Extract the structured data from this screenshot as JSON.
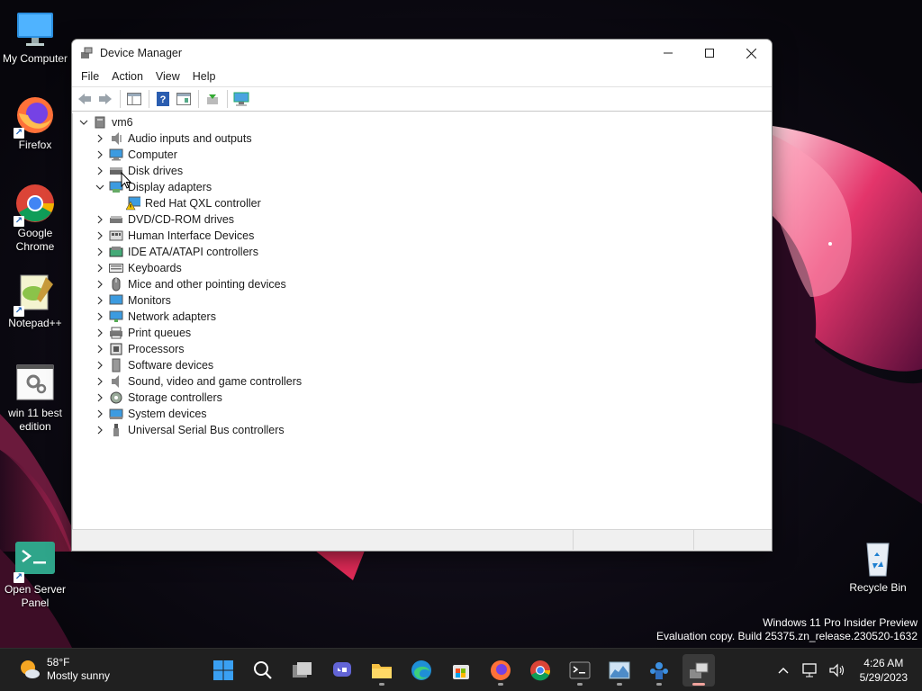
{
  "desktop": {
    "icons": [
      {
        "label": "My Computer"
      },
      {
        "label": "Firefox"
      },
      {
        "label": "Google Chrome"
      },
      {
        "label": "Notepad++"
      },
      {
        "label": "win 11 best edition"
      },
      {
        "label": "Open Server Panel"
      },
      {
        "label": "Recycle Bin"
      }
    ]
  },
  "window": {
    "title": "Device Manager",
    "menu": [
      "File",
      "Action",
      "View",
      "Help"
    ],
    "tree": {
      "root": "vm6",
      "items": [
        {
          "label": "Audio inputs and outputs",
          "icon": "speaker-icon"
        },
        {
          "label": "Computer",
          "icon": "computer-icon"
        },
        {
          "label": "Disk drives",
          "icon": "disk-drive-icon"
        },
        {
          "label": "Display adapters",
          "icon": "display-adapter-icon",
          "expanded": true,
          "children": [
            {
              "label": "Red Hat QXL controller",
              "icon": "warning-adapter-icon"
            }
          ]
        },
        {
          "label": "DVD/CD-ROM drives",
          "icon": "dvd-drive-icon"
        },
        {
          "label": "Human Interface Devices",
          "icon": "hid-icon"
        },
        {
          "label": "IDE ATA/ATAPI controllers",
          "icon": "ide-controller-icon"
        },
        {
          "label": "Keyboards",
          "icon": "keyboard-icon"
        },
        {
          "label": "Mice and other pointing devices",
          "icon": "mouse-icon"
        },
        {
          "label": "Monitors",
          "icon": "monitor-icon"
        },
        {
          "label": "Network adapters",
          "icon": "network-adapter-icon"
        },
        {
          "label": "Print queues",
          "icon": "printer-icon"
        },
        {
          "label": "Processors",
          "icon": "processor-icon"
        },
        {
          "label": "Software devices",
          "icon": "software-device-icon"
        },
        {
          "label": "Sound, video and game controllers",
          "icon": "sound-icon"
        },
        {
          "label": "Storage controllers",
          "icon": "storage-controller-icon"
        },
        {
          "label": "System devices",
          "icon": "system-device-icon"
        },
        {
          "label": "Universal Serial Bus controllers",
          "icon": "usb-icon"
        }
      ]
    }
  },
  "watermark": {
    "line1": "Windows 11 Pro Insider Preview",
    "line2": "Evaluation copy. Build 25375.zn_release.230520-1632"
  },
  "taskbar": {
    "weather": {
      "temp": "58°F",
      "condition": "Mostly sunny"
    },
    "clock": {
      "time": "4:26 AM",
      "date": "5/29/2023"
    }
  }
}
